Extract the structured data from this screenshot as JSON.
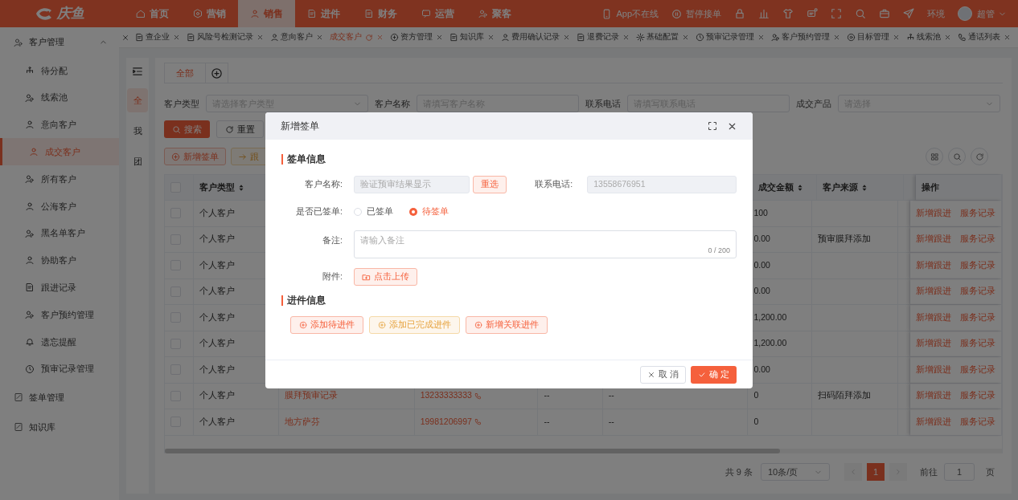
{
  "top_nav": {
    "logo": "庆鱼",
    "items": [
      {
        "label": "首页",
        "selected": false
      },
      {
        "label": "营销",
        "selected": false
      },
      {
        "label": "销售",
        "selected": true
      },
      {
        "label": "进件",
        "selected": false
      },
      {
        "label": "财务",
        "selected": false
      },
      {
        "label": "运营",
        "selected": false
      },
      {
        "label": "聚客",
        "selected": false
      }
    ],
    "status": [
      "App不在线",
      "暂停接单"
    ],
    "env": "环境",
    "user": "超管"
  },
  "page_tabs": [
    {
      "label": "查企业",
      "selected": false
    },
    {
      "label": "风险号检测记录",
      "selected": false
    },
    {
      "label": "意向客户",
      "selected": false
    },
    {
      "label": "成交客户",
      "selected": true
    },
    {
      "label": "资方管理",
      "selected": false
    },
    {
      "label": "知识库",
      "selected": false
    },
    {
      "label": "费用确认记录",
      "selected": false
    },
    {
      "label": "退费记录",
      "selected": false
    },
    {
      "label": "基础配置",
      "selected": false
    },
    {
      "label": "预审记录管理",
      "selected": false
    },
    {
      "label": "客户预约管理",
      "selected": false
    },
    {
      "label": "目标管理",
      "selected": false
    },
    {
      "label": "线索池",
      "selected": false
    },
    {
      "label": "通话列表",
      "selected": false
    }
  ],
  "sidebar": {
    "items": [
      {
        "label": "客户管理",
        "expanded": true,
        "children": [
          {
            "label": "待分配",
            "selected": false
          },
          {
            "label": "线索池",
            "selected": false
          },
          {
            "label": "意向客户",
            "selected": false
          },
          {
            "label": "成交客户",
            "selected": true
          },
          {
            "label": "所有客户",
            "selected": false
          },
          {
            "label": "公海客户",
            "selected": false
          },
          {
            "label": "黑名单客户",
            "selected": false
          },
          {
            "label": "协助客户",
            "selected": false
          },
          {
            "label": "跟进记录",
            "selected": false
          },
          {
            "label": "客户预约管理",
            "selected": false
          },
          {
            "label": "遗忘提醒",
            "selected": false
          },
          {
            "label": "预审记录管理",
            "selected": false
          }
        ]
      },
      {
        "label": "签单管理"
      },
      {
        "label": "知识库"
      }
    ]
  },
  "scope_tabs": [
    {
      "label": "全",
      "selected": true
    },
    {
      "label": "我",
      "selected": false
    },
    {
      "label": "团",
      "selected": false
    }
  ],
  "view_tabs": [
    {
      "label": "全部",
      "selected": true
    }
  ],
  "filters": [
    {
      "label": "客户类型",
      "placeholder": "请选择客户类型",
      "kind": "select"
    },
    {
      "label": "客户名称",
      "placeholder": "请填写客户名称",
      "kind": "input"
    },
    {
      "label": "联系电话",
      "placeholder": "请填写联系电话",
      "kind": "input"
    },
    {
      "label": "成交产品",
      "placeholder": "请选择",
      "kind": "select"
    }
  ],
  "filter_buttons": {
    "search": "搜索",
    "reset": "重置"
  },
  "toolbar": {
    "add": "新增签单",
    "follow": "跟"
  },
  "table": {
    "all_checked": false,
    "columns": [
      {
        "label": "客户类型"
      },
      {
        "label": "成交金额"
      },
      {
        "label": "客户来源"
      },
      {
        "label": "操作"
      }
    ],
    "rows": [
      {
        "checked": false,
        "customer_type": "个人客户",
        "amount": "100",
        "actions": [
          "新增跟进",
          "服务记录"
        ]
      },
      {
        "checked": false,
        "customer_type": "个人客户",
        "amount": "0.00",
        "source": "预审膜拜添加",
        "actions": [
          "新增跟进",
          "服务记录"
        ]
      },
      {
        "checked": false,
        "customer_type": "个人客户",
        "amount": "0.00",
        "actions": [
          "新增跟进",
          "服务记录"
        ]
      },
      {
        "checked": false,
        "customer_type": "个人客户",
        "amount": "0.00",
        "actions": [
          "新增跟进",
          "服务记录"
        ]
      },
      {
        "checked": false,
        "customer_type": "个人客户",
        "amount": "1,200.00",
        "actions": [
          "新增跟进",
          "服务记录"
        ]
      },
      {
        "checked": false,
        "customer_type": "个人客户",
        "amount": "1,200.00",
        "actions": [
          "新增跟进",
          "服务记录"
        ]
      },
      {
        "checked": false,
        "customer_type": "个人客户",
        "amount": "0.00",
        "actions": [
          "新增跟进",
          "服务记录"
        ]
      },
      {
        "checked": false,
        "customer_type": "个人客户",
        "name": "膜拜预审记录",
        "phone": "13233333333",
        "column_5": "--",
        "column_6": "--",
        "amount": "0",
        "source": "扫码陌拜添加",
        "actions": [
          "新增跟进",
          "服务记录"
        ]
      },
      {
        "checked": false,
        "customer_type": "个人客户",
        "name": "地方萨芬",
        "phone": "19981206997",
        "column_5": "--",
        "column_6": "--",
        "amount": "0",
        "actions": [
          "新增跟进",
          "服务记录"
        ]
      }
    ]
  },
  "pagination": {
    "total": "共 9 条",
    "page_size": "10条/页",
    "pages": [
      {
        "label": "1",
        "selected": true
      }
    ],
    "goto_label": "前往",
    "goto_value": "1",
    "page_suffix": "页"
  },
  "dialog": {
    "title": "新增签单",
    "section_1": "签单信息",
    "customer_name": {
      "label": "客户名称:",
      "placeholder": "验证预审结果显示",
      "disabled": true
    },
    "reselect": "重选",
    "phone": {
      "label": "联系电话:",
      "value": "13558676951",
      "disabled": true
    },
    "signed": {
      "label": "是否已签单:",
      "options": [
        {
          "label": "已签单",
          "selected": false
        },
        {
          "label": "待签单",
          "selected": true
        }
      ]
    },
    "remark": {
      "label": "备注:",
      "placeholder": "请输入备注",
      "counter": "0 / 200"
    },
    "attachment": {
      "label": "附件:",
      "button": "点击上传"
    },
    "section_2": "进件信息",
    "actions": [
      {
        "label": "添加待进件",
        "kind": "danger"
      },
      {
        "label": "添加已完成进件",
        "kind": "warning"
      },
      {
        "label": "新增关联进件",
        "kind": "danger"
      }
    ],
    "cancel": "取 消",
    "confirm": "确 定"
  }
}
